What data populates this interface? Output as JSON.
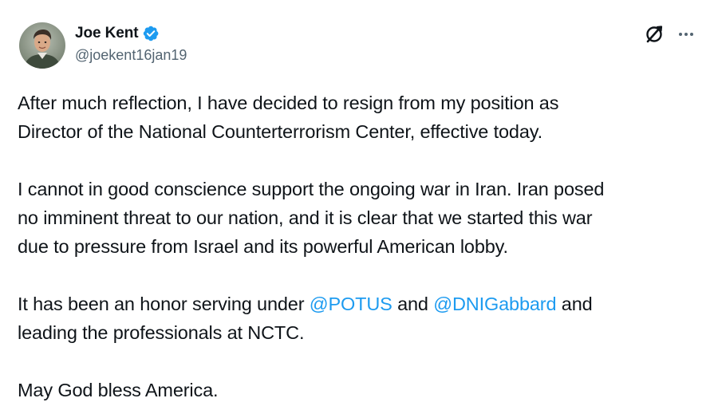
{
  "author": {
    "display_name": "Joe Kent",
    "handle": "@joekent16jan19",
    "verified": true
  },
  "icons": {
    "verified": "verified-badge-icon",
    "grok": "grok-icon",
    "more": "more-options-icon"
  },
  "colors": {
    "mention": "#1d9bf0",
    "verified_badge": "#1d9bf0",
    "secondary_text": "#536471"
  },
  "tweet": {
    "p1": {
      "line1": "After much reflection, I have decided to resign from my position as",
      "line2": "Director of the National Counterterrorism Center, effective today."
    },
    "p2": {
      "line1": "I cannot in good conscience support the ongoing war in Iran. Iran posed",
      "line2": "no imminent threat to our nation, and it is clear that we started this war",
      "line3": "due to pressure from Israel and its powerful American lobby."
    },
    "p3": {
      "text_before": "It has been an honor serving under ",
      "mention1": "@POTUS",
      "text_between": " and ",
      "mention2": "@DNIGabbard",
      "text_after": " and",
      "line2": "leading the professionals at NCTC."
    },
    "p4": {
      "line1": "May God bless America."
    }
  }
}
